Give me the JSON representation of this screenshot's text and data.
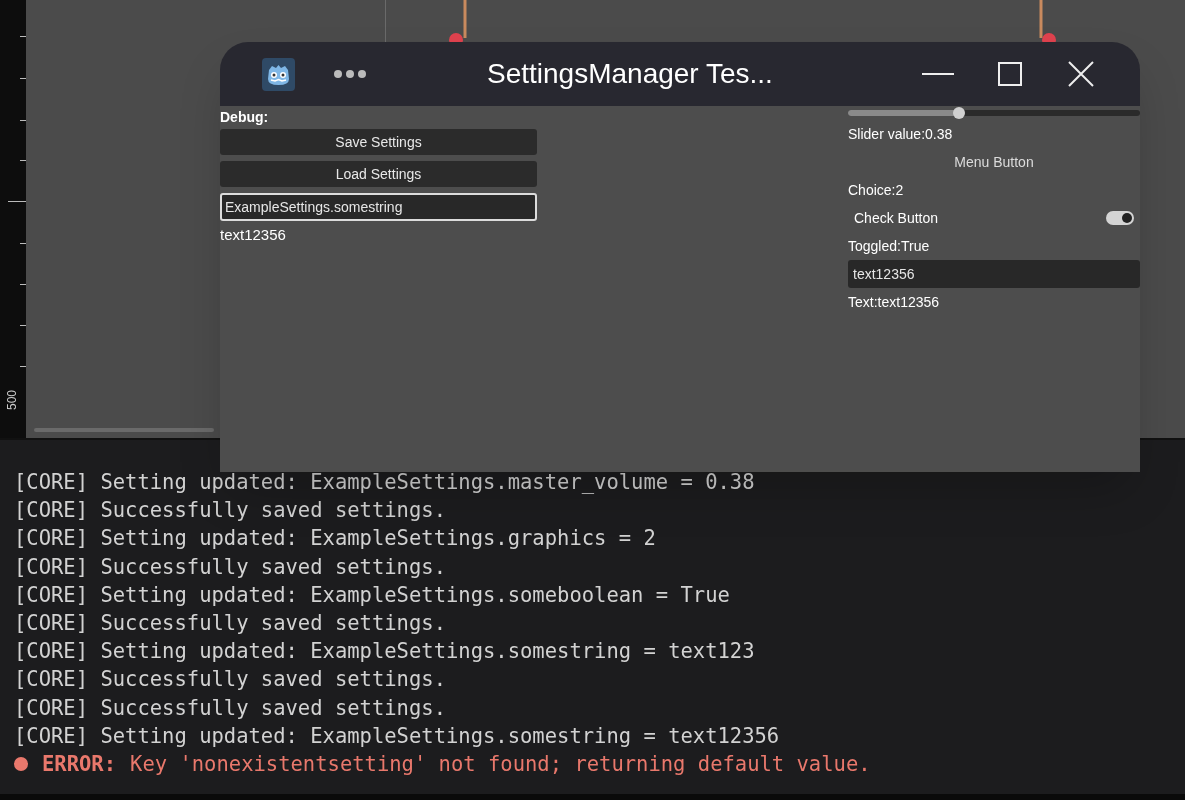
{
  "ruler": {
    "label": "500"
  },
  "window": {
    "title": "SettingsManager Tes...",
    "debug_label": "Debug:",
    "buttons": [
      "Save Settings",
      "Load Settings"
    ],
    "key_field": {
      "value": "ExampleSettings.somestring",
      "focused": true
    },
    "key_result": "text12356",
    "slider": {
      "level": 0.38
    },
    "slider_label": "Slider value:0.38",
    "menu_button": "Menu Button",
    "choice_label": "Choice:2",
    "check_button": {
      "label": "Check Button",
      "on": true
    },
    "toggled_label": "Toggled:True",
    "text_field": {
      "value": "text12356",
      "focused": false
    },
    "text_label": "Text:text12356"
  },
  "console": {
    "lines": [
      {
        "kind": "info",
        "text": "[CORE] Setting updated: ExampleSettings.master_volume = 0.38"
      },
      {
        "kind": "info",
        "text": "[CORE] Successfully saved settings."
      },
      {
        "kind": "info",
        "text": "[CORE] Setting updated: ExampleSettings.graphics = 2"
      },
      {
        "kind": "info",
        "text": "[CORE] Successfully saved settings."
      },
      {
        "kind": "info",
        "text": "[CORE] Setting updated: ExampleSettings.someboolean = True"
      },
      {
        "kind": "info",
        "text": "[CORE] Successfully saved settings."
      },
      {
        "kind": "info",
        "text": "[CORE] Setting updated: ExampleSettings.somestring = text123"
      },
      {
        "kind": "info",
        "text": "[CORE] Successfully saved settings."
      },
      {
        "kind": "info",
        "text": "[CORE] Successfully saved settings."
      },
      {
        "kind": "info",
        "text": "[CORE] Setting updated: ExampleSettings.somestring = text12356"
      },
      {
        "kind": "error",
        "prefix": "ERROR:",
        "text": "Key 'nonexistentsetting' not found; returning default value."
      }
    ]
  }
}
